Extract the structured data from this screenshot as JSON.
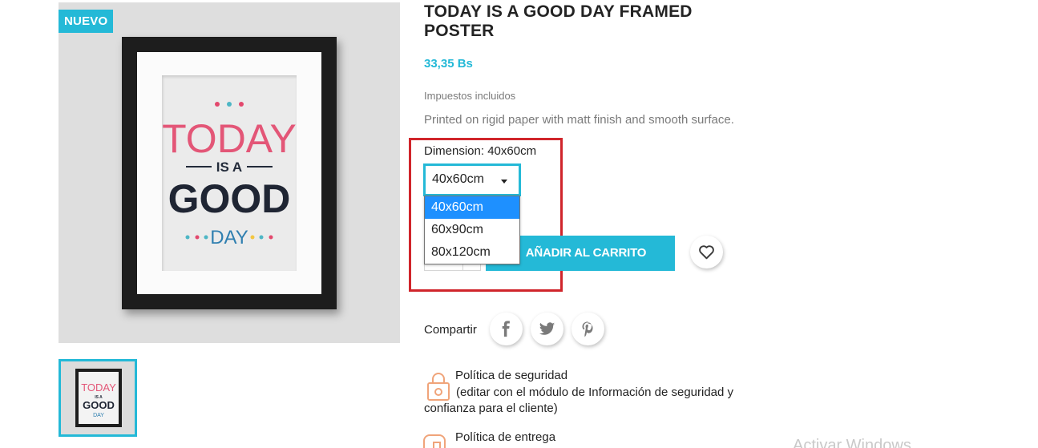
{
  "product": {
    "badge": "NUEVO",
    "title": "TODAY IS A GOOD DAY FRAMED POSTER",
    "price": "33,35 Bs",
    "taxes_note": "Impuestos incluidos",
    "description": "Printed on rigid paper with matt finish and smooth surface.",
    "poster_text": {
      "line1": "TODAY",
      "line2": "IS A",
      "line3": "GOOD",
      "line4": "DAY"
    }
  },
  "dimension": {
    "label": "Dimension: 40x60cm",
    "selected": "40x60cm",
    "options": [
      {
        "label": "40x60cm",
        "selected": true
      },
      {
        "label": "60x90cm",
        "selected": false
      },
      {
        "label": "80x120cm",
        "selected": false
      }
    ]
  },
  "cart": {
    "button_label": "AÑADIR AL CARRITO"
  },
  "share": {
    "label": "Compartir",
    "networks": [
      "facebook",
      "twitter",
      "pinterest"
    ]
  },
  "reassurance": [
    {
      "title": "Política de seguridad",
      "text": "(editar con el módulo de Información de seguridad y confianza para el cliente)",
      "icon": "lock-icon"
    },
    {
      "title": "Política de entrega",
      "icon": "truck-icon"
    }
  ],
  "watermark": "Activar Windows",
  "colors": {
    "accent": "#24b9d7",
    "highlight": "#d0252b",
    "option_selected": "#1e90ff"
  }
}
